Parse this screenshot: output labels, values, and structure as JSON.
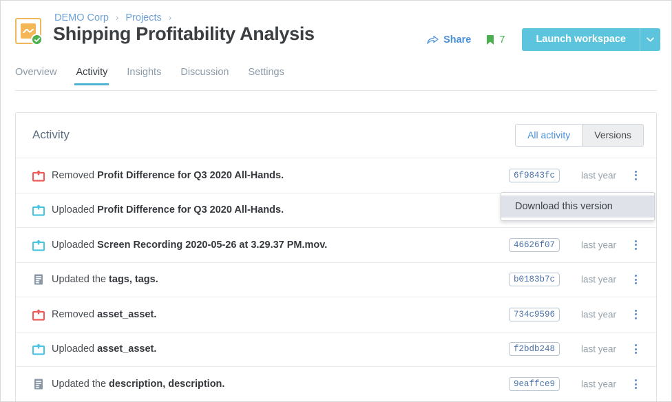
{
  "header": {
    "breadcrumb": [
      {
        "label": "DEMO Corp"
      },
      {
        "label": "Projects"
      }
    ],
    "separator": "›",
    "title": "Shipping Profitability Analysis",
    "share_label": "Share",
    "bookmark_count": "7",
    "launch_label": "Launch workspace",
    "brand_icon": "chart-square-icon",
    "check_badge_icon": "check-circle-icon",
    "share_icon": "share-arrow-icon",
    "bookmark_icon": "bookmark-icon",
    "caret_icon": "chevron-down-icon",
    "colors": {
      "accent_blue": "#5cc4dd",
      "link_blue": "#4a90d9",
      "brand_orange": "#f5b657",
      "check_green": "#4caf50",
      "tab_underline": "#4eb3d3"
    }
  },
  "tabs": [
    {
      "label": "Overview",
      "active": false
    },
    {
      "label": "Activity",
      "active": true
    },
    {
      "label": "Insights",
      "active": false
    },
    {
      "label": "Discussion",
      "active": false
    },
    {
      "label": "Settings",
      "active": false
    }
  ],
  "card": {
    "title": "Activity",
    "segments": [
      {
        "label": "All activity",
        "active": true
      },
      {
        "label": "Versions",
        "active": false
      }
    ]
  },
  "activity": {
    "rows": [
      {
        "icon": "removed-upload-icon",
        "icon_kind": "removed",
        "action": "Removed ",
        "subject": "Profit Difference for Q3 2020 All-Hands.",
        "hash": "6f9843fc",
        "time": "last year"
      },
      {
        "icon": "uploaded-upload-icon",
        "icon_kind": "uploaded",
        "action": "Uploaded ",
        "subject": "Profit Difference for Q3 2020 All-Hands.",
        "hash": "",
        "time": ""
      },
      {
        "icon": "uploaded-upload-icon",
        "icon_kind": "uploaded",
        "action": "Uploaded ",
        "subject": "Screen Recording 2020-05-26 at 3.29.37 PM.mov.",
        "hash": "46626f07",
        "time": "last year"
      },
      {
        "icon": "document-icon",
        "icon_kind": "updated",
        "action": "Updated the ",
        "subject": "tags, tags.",
        "hash": "b0183b7c",
        "time": "last year"
      },
      {
        "icon": "removed-upload-icon",
        "icon_kind": "removed",
        "action": "Removed ",
        "subject": "asset_asset.",
        "hash": "734c9596",
        "time": "last year"
      },
      {
        "icon": "uploaded-upload-icon",
        "icon_kind": "uploaded",
        "action": "Uploaded ",
        "subject": "asset_asset.",
        "hash": "f2bdb248",
        "time": "last year"
      },
      {
        "icon": "document-icon",
        "icon_kind": "updated",
        "action": "Updated the ",
        "subject": "description, description.",
        "hash": "9eaffce9",
        "time": "last year"
      }
    ]
  },
  "dropdown": {
    "item_label": "Download this version"
  }
}
